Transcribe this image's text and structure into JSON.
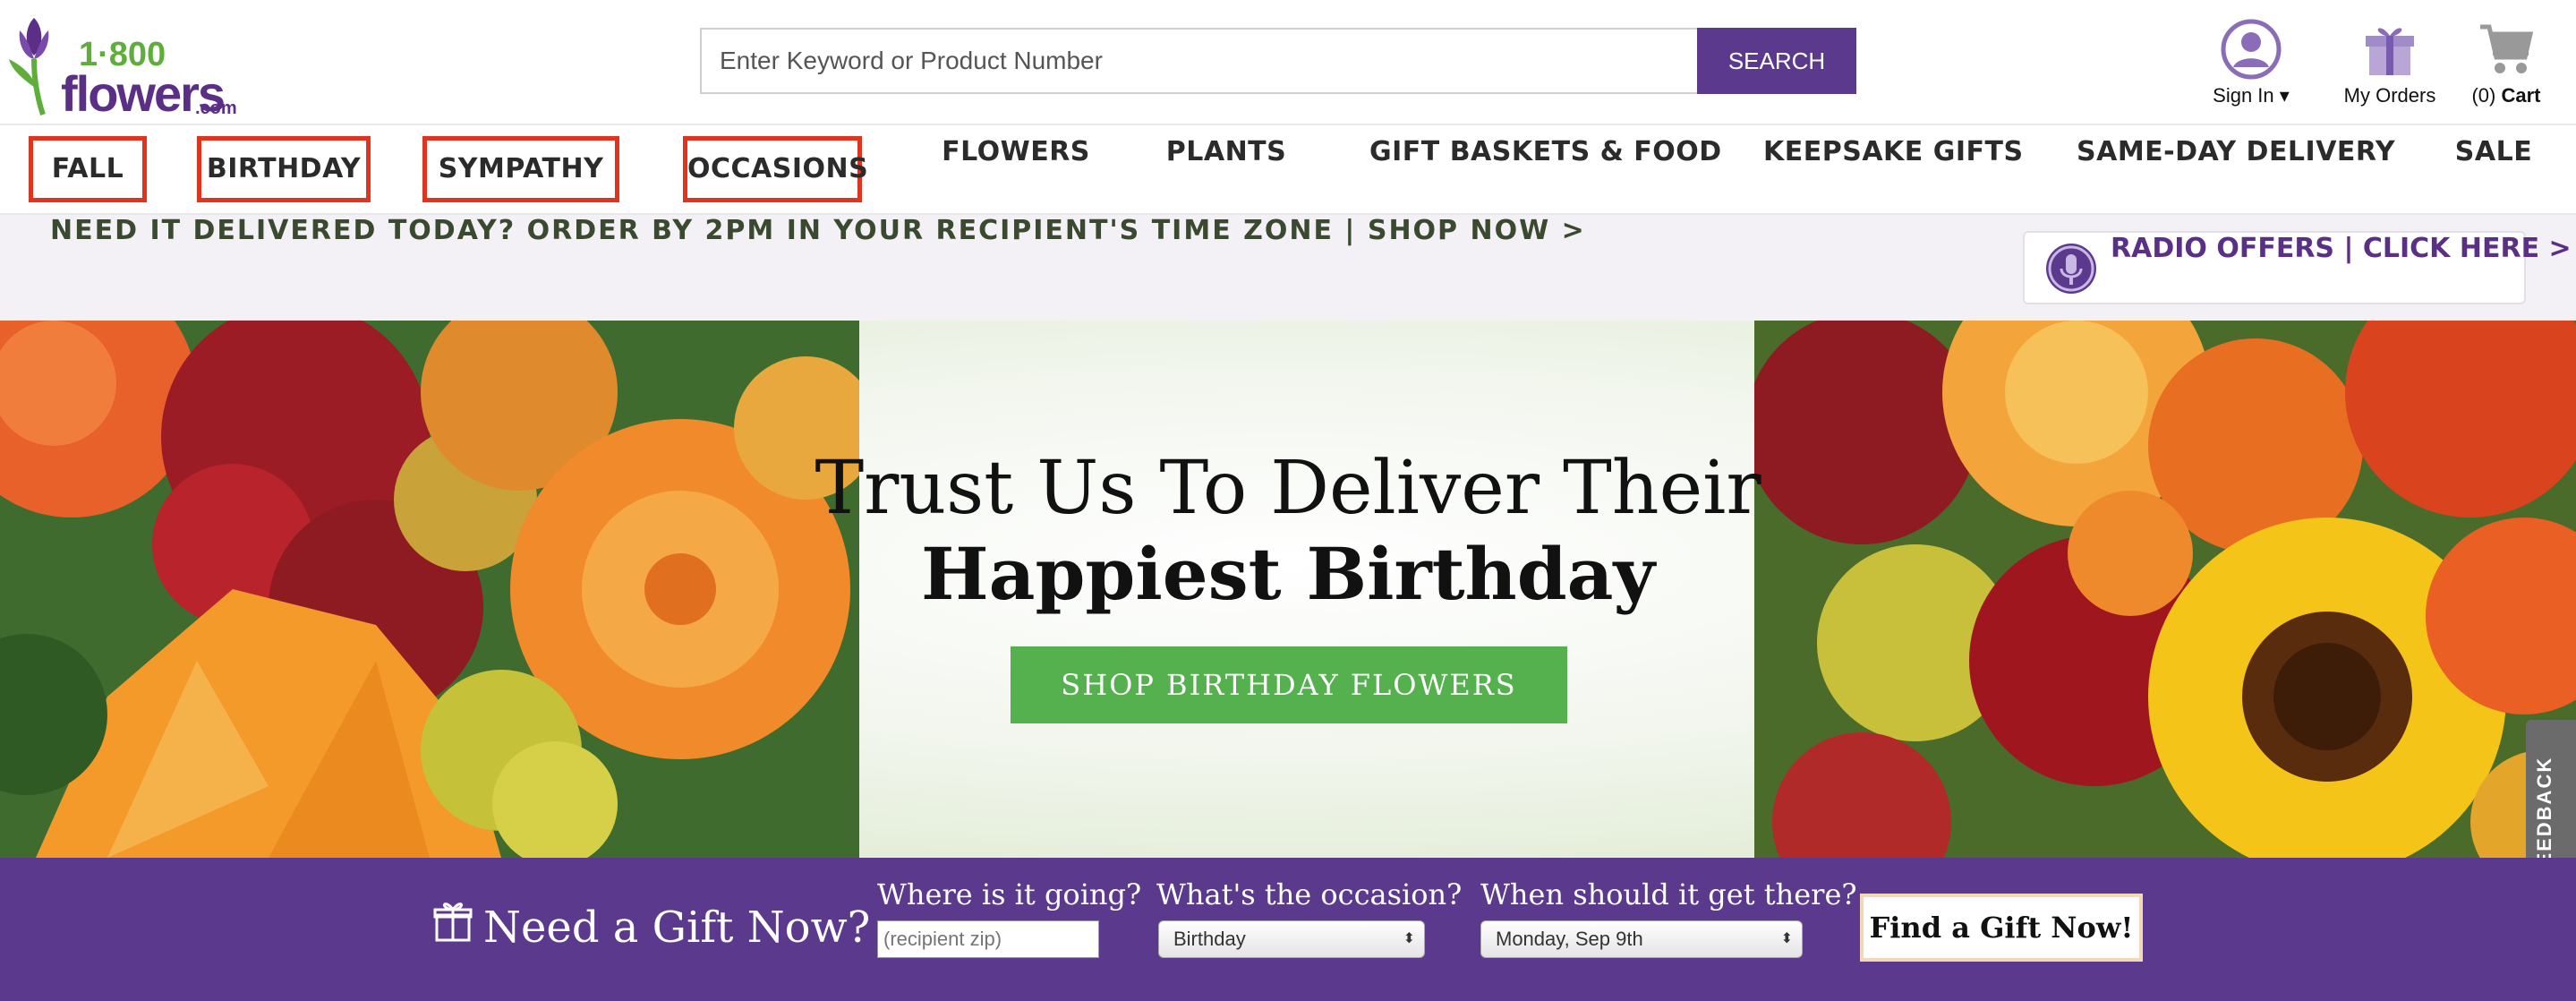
{
  "brand": {
    "logo_top": "1·800",
    "logo_main": "flowers",
    "logo_suffix": ".com",
    "purple": "#5b3a8e",
    "green": "#55b04e"
  },
  "header": {
    "search_placeholder": "Enter Keyword or Product Number",
    "search_button": "SEARCH",
    "sign_in": "Sign In",
    "sign_in_caret": "▾",
    "my_orders": "My Orders",
    "cart_count": "(0)",
    "cart_label": "Cart"
  },
  "nav": {
    "items": [
      {
        "label": "FALL",
        "boxed": true
      },
      {
        "label": "BIRTHDAY",
        "boxed": true
      },
      {
        "label": "SYMPATHY",
        "boxed": true
      },
      {
        "label": "OCCASIONS",
        "boxed": true
      },
      {
        "label": "FLOWERS",
        "boxed": false
      },
      {
        "label": "PLANTS",
        "boxed": false
      },
      {
        "label": "GIFT BASKETS & FOOD",
        "boxed": false
      },
      {
        "label": "KEEPSAKE GIFTS",
        "boxed": false
      },
      {
        "label": "SAME-DAY DELIVERY",
        "boxed": false
      },
      {
        "label": "SALE",
        "boxed": false
      }
    ],
    "highlight_color": "#e0341f"
  },
  "promo": {
    "text": "NEED IT DELIVERED TODAY? ORDER BY 2PM IN YOUR RECIPIENT'S TIME ZONE | SHOP NOW >",
    "radio_text": "RADIO OFFERS | CLICK HERE >"
  },
  "hero": {
    "line1": "Trust Us To Deliver Their",
    "line2": "Happiest Birthday",
    "cta": "SHOP BIRTHDAY FLOWERS"
  },
  "feedback": {
    "label": "FEEDBACK"
  },
  "gift_finder": {
    "title": "Need a Gift Now?",
    "where_label": "Where is it going?",
    "where_placeholder": "(recipient zip)",
    "occasion_label": "What's the occasion?",
    "occasion_value": "Birthday",
    "when_label": "When should it get there?",
    "when_value": "Monday, Sep 9th",
    "button": "Find a Gift Now!"
  }
}
